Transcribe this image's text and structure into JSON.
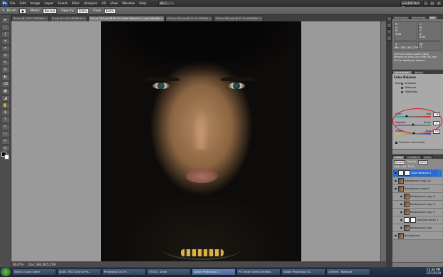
{
  "app": {
    "logo": "Ps",
    "menu": [
      "File",
      "Edit",
      "Image",
      "Layer",
      "Select",
      "Filter",
      "Analysis",
      "3D",
      "View",
      "Window",
      "Help"
    ],
    "zoom": "66.7",
    "workspace": "ESSENTIALS ▾",
    "window_buttons": [
      "–",
      "□",
      "×"
    ]
  },
  "options_bar": {
    "brush_label": "Brush:",
    "mode_label": "Mode:",
    "mode_value": "Normal",
    "opacity_label": "Opacity:",
    "opacity_value": "100%",
    "flow_label": "Flow:",
    "flow_value": "100%"
  },
  "document_tabs": [
    {
      "label": "IN.psd @ 100% (RGB/8#) ×",
      "active": false
    },
    {
      "label": "III.psd @ 100% (RGB/8#) ×",
      "active": false
    },
    {
      "label": "Picture 295.psd @ 66.7% (Color Balance 1, Layer Mask/8) ×",
      "active": true
    },
    {
      "label": "Picture 295.psd @ 33.3% (RGB/8) ×",
      "active": false
    },
    {
      "label": "Picture 895.psd @ 33.3% (RGB/8#) ×",
      "active": false
    }
  ],
  "tools": [
    "▸",
    "⬚",
    "ʃ",
    "✦",
    "⌗",
    "⊘",
    "✎",
    "⎘",
    "◐",
    "⌫",
    "▣",
    "◢",
    "✋",
    "⊕",
    "T",
    "↖",
    "▭",
    "✐",
    "◎",
    "☰"
  ],
  "status_bar": {
    "zoom": "66.67%",
    "doc": "Doc: 386.2K/5.27M"
  },
  "info_panel": {
    "tabs": [
      "HISTOGRAM",
      "NAVIGATOR",
      "INFO"
    ],
    "cells": [
      "R:\nG:\nB:\n8-bit",
      "C:\nM:\nY:\nK:\n8-bit",
      "X:\nY:",
      "W:\nH:"
    ],
    "doc": "Doc: 386.2K/5.27M",
    "hint": "Click and drag to paint using foreground color. Use Shift, Alt, and Ctrl for additional options."
  },
  "adjustments": {
    "tabs": [
      "ADJUSTMENTS",
      "MASKS"
    ],
    "title": "Color Balance",
    "tone_label": "Tone:",
    "tones": [
      {
        "label": "Shadows",
        "checked": false
      },
      {
        "label": "Midtones",
        "checked": true
      },
      {
        "label": "Highlights",
        "checked": false
      }
    ],
    "sliders": [
      {
        "left": "Cyan",
        "right": "Red",
        "value": "-36",
        "color": "#1fb7c9",
        "color_end": "#d2312a",
        "level": -36
      },
      {
        "left": "Magenta",
        "right": "Green",
        "value": "0",
        "color": "#c83ac0",
        "color_end": "#2aa84a",
        "level": 0
      },
      {
        "left": "Yellow",
        "right": "Blue",
        "value": "+3",
        "color": "#d9c92a",
        "color_end": "#2b4fd4",
        "level": 3
      }
    ],
    "preserve_label": "Preserve Luminosity"
  },
  "layers": {
    "tabs": [
      "LAYERS",
      "CHANNELS",
      "PATHS"
    ],
    "blend": "Normal",
    "opacity_label": "Opacity:",
    "opacity": "100%",
    "lock_label": "Lock:",
    "fill_label": "Fill:",
    "fill": "100%",
    "rows": [
      {
        "name": "Color Balance 1",
        "thumb": "adj",
        "active": true,
        "child": false
      },
      {
        "name": "Background copy 10",
        "thumb": "photo",
        "active": false,
        "child": false
      },
      {
        "name": "Background copy 9",
        "thumb": "photo",
        "active": false,
        "child": false
      },
      {
        "name": "Background copy 4",
        "thumb": "photo",
        "active": false,
        "child": true
      },
      {
        "name": "Background copy 3",
        "thumb": "photo",
        "active": false,
        "child": true
      },
      {
        "name": "Background copy 2",
        "thumb": "photo",
        "active": false,
        "child": true
      },
      {
        "name": "Hue/Saturation 1",
        "thumb": "adj",
        "active": false,
        "child": true
      },
      {
        "name": "Background copy",
        "thumb": "photo",
        "active": false,
        "child": true
      },
      {
        "name": "Background",
        "thumb": "photo",
        "active": false,
        "child": false
      }
    ]
  },
  "taskbar": {
    "buttons": [
      {
        "label": "Work & Clone Client",
        "active": false
      },
      {
        "label": "gtalk - MOZ Zine 04 Pa...",
        "active": false
      },
      {
        "label": "Photoshop CS4 Pl...",
        "active": false
      },
      {
        "label": "STOCK - Dead",
        "active": false
      },
      {
        "label": "Adobe Photoshop C...",
        "active": true
      },
      {
        "label": "PS Cheat Sheet (Untitled...",
        "active": false
      },
      {
        "label": "Adobe Photoshop CS...",
        "active": false
      },
      {
        "label": "Untitled - Notepad",
        "active": false
      }
    ],
    "time": "12:34 PM",
    "date": "1/21/2010"
  }
}
